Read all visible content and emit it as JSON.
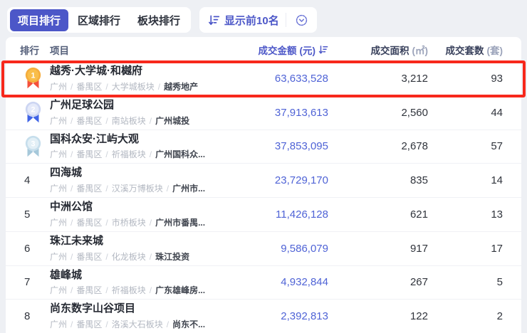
{
  "toolbar": {
    "tabs": [
      {
        "label": "项目排行",
        "active": true
      },
      {
        "label": "区域排行",
        "active": false
      },
      {
        "label": "板块排行",
        "active": false
      }
    ],
    "filter": {
      "label": "显示前10名"
    },
    "icons": {
      "sort": "sort-descending-icon",
      "collapse": "circle-chevron-down-icon"
    }
  },
  "table": {
    "separator": "/",
    "headers": {
      "rank": "排行",
      "project": "项目",
      "amount_label": "成交金额",
      "amount_unit": "(元)",
      "area_label": "成交面积",
      "area_unit": "(㎡)",
      "count_label": "成交套数",
      "count_unit": "(套)"
    },
    "rows": [
      {
        "rank": "1",
        "medal": "gold",
        "name": "越秀·大学城·和樾府",
        "city": "广州",
        "district": "番禺区",
        "block": "大学城板块",
        "developer": "越秀地产",
        "amount": "63,633,528",
        "area": "3,212",
        "count": "93",
        "highlighted": true
      },
      {
        "rank": "2",
        "medal": "silver",
        "name": "广州足球公园",
        "city": "广州",
        "district": "番禺区",
        "block": "南站板块",
        "developer": "广州城投",
        "amount": "37,913,613",
        "area": "2,560",
        "count": "44",
        "highlighted": false
      },
      {
        "rank": "3",
        "medal": "bronze",
        "name": "国科众安·江屿大观",
        "city": "广州",
        "district": "番禺区",
        "block": "祈福板块",
        "developer": "广州国科众...",
        "amount": "37,853,095",
        "area": "2,678",
        "count": "57",
        "highlighted": false
      },
      {
        "rank": "4",
        "medal": null,
        "name": "四海城",
        "city": "广州",
        "district": "番禺区",
        "block": "汉溪万博板块",
        "developer": "广州市...",
        "amount": "23,729,170",
        "area": "835",
        "count": "14",
        "highlighted": false
      },
      {
        "rank": "5",
        "medal": null,
        "name": "中洲公馆",
        "city": "广州",
        "district": "番禺区",
        "block": "市桥板块",
        "developer": "广州市番禺...",
        "amount": "11,426,128",
        "area": "621",
        "count": "13",
        "highlighted": false
      },
      {
        "rank": "6",
        "medal": null,
        "name": "珠江未来城",
        "city": "广州",
        "district": "番禺区",
        "block": "化龙板块",
        "developer": "珠江投资",
        "amount": "9,586,079",
        "area": "917",
        "count": "17",
        "highlighted": false
      },
      {
        "rank": "7",
        "medal": null,
        "name": "雄峰城",
        "city": "广州",
        "district": "番禺区",
        "block": "祈福板块",
        "developer": "广东雄峰房...",
        "amount": "4,932,844",
        "area": "267",
        "count": "5",
        "highlighted": false
      },
      {
        "rank": "8",
        "medal": null,
        "name": "尚东数字山谷项目",
        "city": "广州",
        "district": "番禺区",
        "block": "洛溪大石板块",
        "developer": "尚东不...",
        "amount": "2,392,813",
        "area": "122",
        "count": "2",
        "highlighted": false
      }
    ]
  },
  "colors": {
    "accent_indigo": "#4C57C8",
    "amount_blue": "#4F63D6",
    "highlight_red": "#F7281C",
    "medal_gold": "#F5AD3D",
    "medal_silver": "#CCD5F2",
    "medal_bronze": "#C6DEEC",
    "page_background": "#EEF0F4"
  }
}
